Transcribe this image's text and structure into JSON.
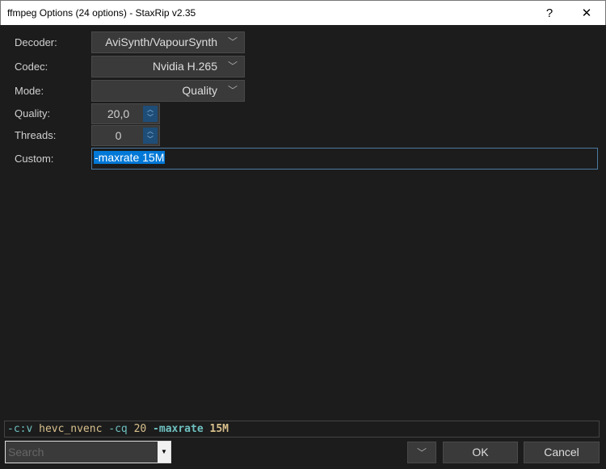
{
  "window": {
    "title": "ffmpeg Options (24 options) - StaxRip v2.35",
    "help": "?",
    "close": "✕"
  },
  "form": {
    "decoder": {
      "label": "Decoder:",
      "value": "AviSynth/VapourSynth"
    },
    "codec": {
      "label": "Codec:",
      "value": "Nvidia H.265"
    },
    "mode": {
      "label": "Mode:",
      "value": "Quality"
    },
    "quality": {
      "label": "Quality:",
      "value": "20,0"
    },
    "threads": {
      "label": "Threads:",
      "value": "0"
    },
    "custom": {
      "label": "Custom:",
      "value": "-maxrate 15M"
    }
  },
  "command_line": {
    "parts": [
      "-c:v",
      "hevc_nvenc",
      "-cq",
      "20",
      "-maxrate",
      "15M"
    ]
  },
  "footer": {
    "search_placeholder": "Search",
    "ok": "OK",
    "cancel": "Cancel"
  }
}
